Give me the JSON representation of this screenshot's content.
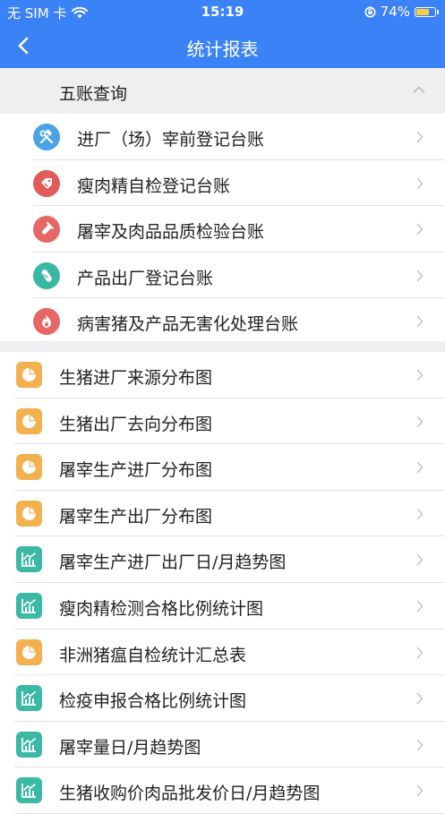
{
  "status_bar": {
    "carrier": "无 SIM 卡",
    "time": "15:19",
    "battery": "74%",
    "battery_level": 0.74
  },
  "nav": {
    "title": "统计报表"
  },
  "section": {
    "title": "五账查询",
    "items": [
      {
        "label": "进厂（场）宰前登记台账",
        "icon": "tools-icon",
        "color": "#4aa3e8"
      },
      {
        "label": "瘦肉精自检登记台账",
        "icon": "tag-icon",
        "color": "#e25a5a"
      },
      {
        "label": "屠宰及肉品品质检验台账",
        "icon": "test-tube-icon",
        "color": "#e86565"
      },
      {
        "label": "产品出厂登记台账",
        "icon": "capsule-icon",
        "color": "#39b7a3"
      },
      {
        "label": "病害猪及产品无害化处理台账",
        "icon": "fire-icon",
        "color": "#e86565"
      }
    ]
  },
  "reports": [
    {
      "label": "生猪进厂来源分布图",
      "icon": "pie-chart-icon",
      "color": "#f3b04f"
    },
    {
      "label": "生猪出厂去向分布图",
      "icon": "pie-chart-icon",
      "color": "#f3b04f"
    },
    {
      "label": "屠宰生产进厂分布图",
      "icon": "pie-chart-icon",
      "color": "#f3b04f"
    },
    {
      "label": "屠宰生产出厂分布图",
      "icon": "pie-chart-icon",
      "color": "#f3b04f"
    },
    {
      "label": "屠宰生产进厂出厂日/月趋势图",
      "icon": "trend-chart-icon",
      "color": "#3cb9a5"
    },
    {
      "label": "瘦肉精检测合格比例统计图",
      "icon": "trend-chart-icon",
      "color": "#3cb9a5"
    },
    {
      "label": "非洲猪瘟自检统计汇总表",
      "icon": "pie-chart-icon",
      "color": "#f3b04f"
    },
    {
      "label": "检疫申报合格比例统计图",
      "icon": "trend-chart-icon",
      "color": "#3cb9a5"
    },
    {
      "label": "屠宰量日/月趋势图",
      "icon": "trend-chart-icon",
      "color": "#3cb9a5"
    },
    {
      "label": "生猪收购价肉品批发价日/月趋势图",
      "icon": "trend-chart-icon",
      "color": "#3cb9a5"
    }
  ]
}
